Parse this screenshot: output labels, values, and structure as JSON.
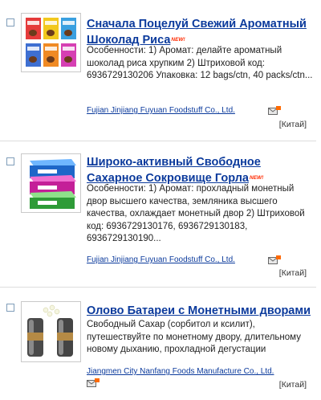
{
  "products": [
    {
      "title": "Сначала Поцелуй Свежий Ароматный Шоколад Риса",
      "badge": "NEW!",
      "description": "Особенности: 1) Аромат: делайте ароматный шоколад риса хрупким 2) Штриховой код: 6936729130206 Упаковка: 12 bags/ctn, 40 packs/ctn...",
      "supplier": "Fujian Jinjiang Fuyuan Foodstuff Co., Ltd.",
      "country": "[Китай]"
    },
    {
      "title": "Широко-активный Свободное Сахарное Сокровище Горла",
      "badge": "NEW!",
      "description": "Особенности: 1) Аромат: прохладный монетный двор высшего качества, земляника высшего качества, охлаждает монетный двор 2) Штриховой код: 6936729130176, 6936729130183, 6936729130190...",
      "supplier": "Fujian Jinjiang Fuyuan Foodstuff Co., Ltd.",
      "country": "[Китай]"
    },
    {
      "title": "Олово Батареи с Монетными дворами",
      "badge": "",
      "description": "Свободный Сахар (сорбитол и ксилит), путешествуйте по монетному двору, длительному новому дыханию, прохладной дегустации",
      "supplier": "Jiangmen City Nanfang Foods Manufacture Co., Ltd.",
      "country": "[Китай]"
    }
  ],
  "icons": {
    "checkbox": "checkbox-icon",
    "contact": "contact-supplier-icon"
  }
}
